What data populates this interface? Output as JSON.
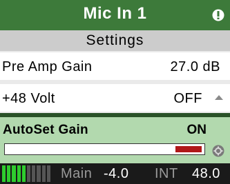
{
  "title_bar": {
    "title": "Mic In 1",
    "icon": "info-icon",
    "color": "#3d7a3a"
  },
  "subtitle": "Settings",
  "rows": [
    {
      "label": "Pre Amp Gain",
      "value": "27.0 dB"
    },
    {
      "label": "+48 Volt",
      "value": "OFF"
    }
  ],
  "autoset": {
    "label": "AutoSet Gain",
    "value": "ON",
    "bar_level": 0.13,
    "bar_color": "#b01818",
    "icon": "settings-icon"
  },
  "status": {
    "meter_segments_on": 5,
    "meter_segments_total": 10,
    "main_label": "Main",
    "main_value": "-4.0",
    "int_label": "INT",
    "int_value": "48.0"
  }
}
